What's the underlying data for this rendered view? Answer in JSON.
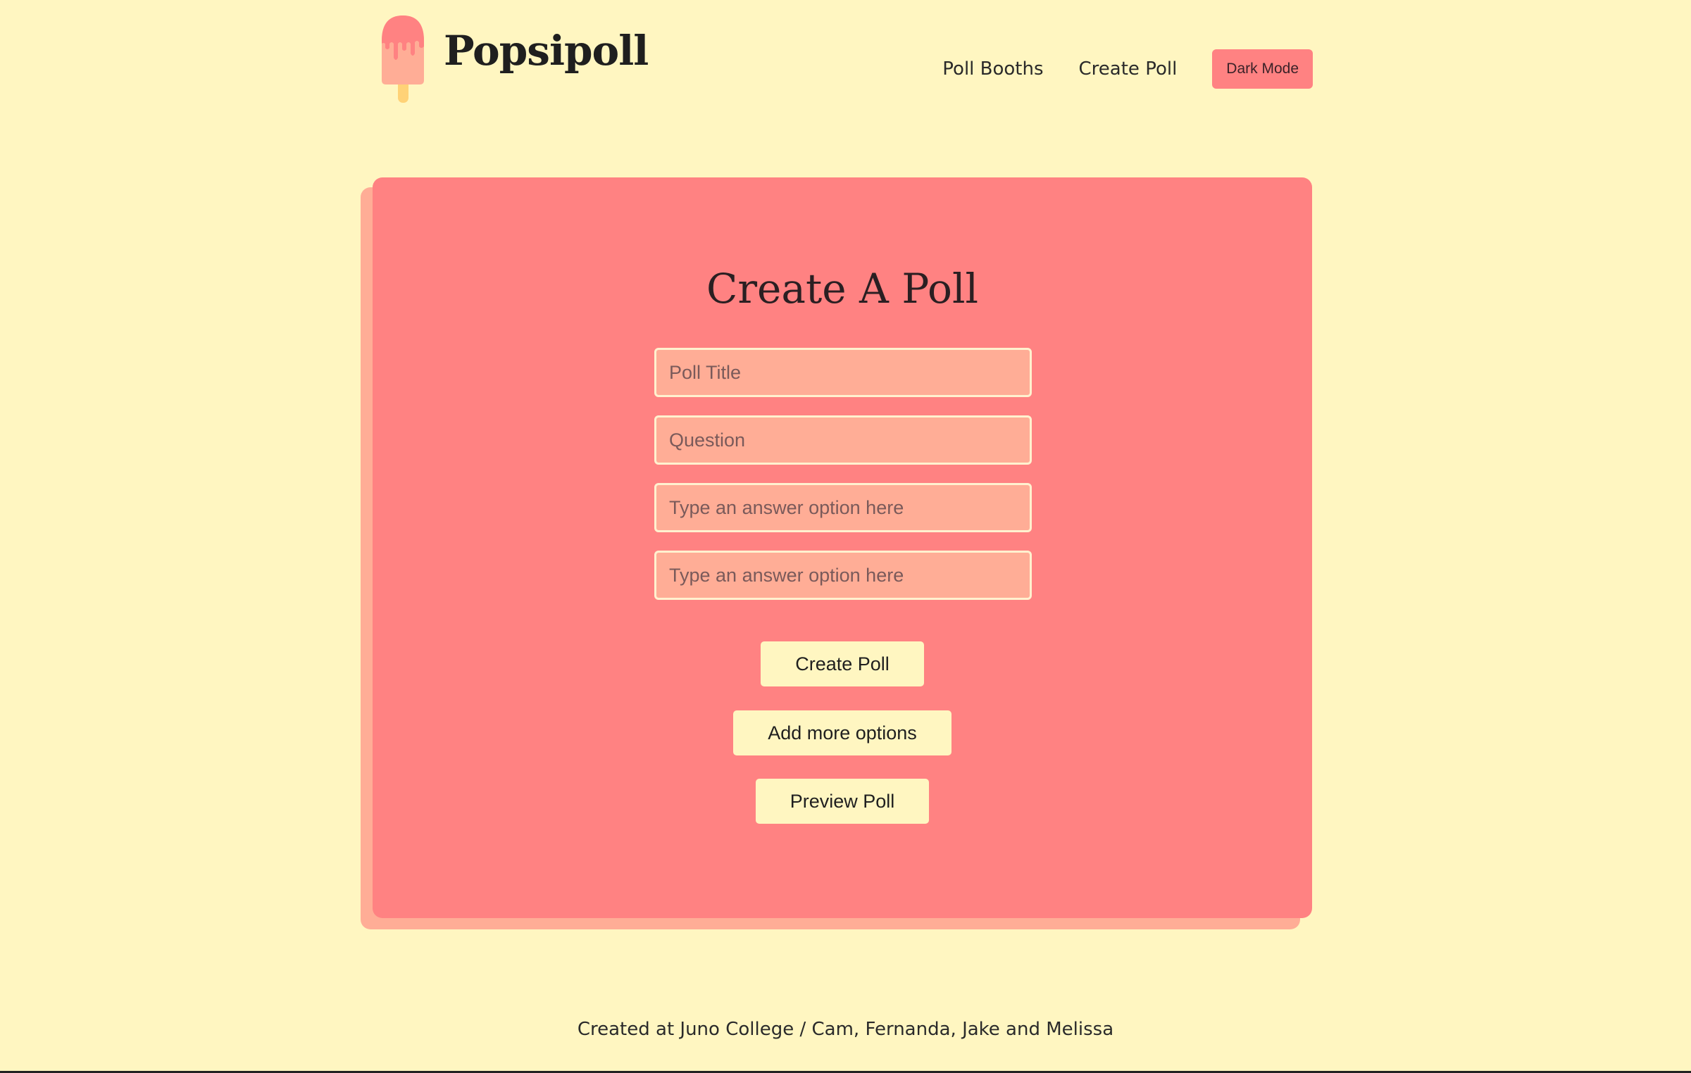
{
  "header": {
    "brand": "Popsipoll",
    "nav": {
      "poll_booths": "Poll Booths",
      "create_poll": "Create Poll",
      "dark_mode": "Dark Mode"
    }
  },
  "card": {
    "title": "Create A Poll",
    "fields": {
      "poll_title_placeholder": "Poll Title",
      "question_placeholder": "Question",
      "option1_placeholder": "Type an answer option here",
      "option2_placeholder": "Type an answer option here"
    },
    "buttons": {
      "create_poll": "Create Poll",
      "add_more_options": "Add more options",
      "preview_poll": "Preview Poll"
    }
  },
  "footer": {
    "text": "Created at Juno College / Cam, Fernanda, Jake and Melissa"
  },
  "colors": {
    "background": "#fff6c1",
    "card": "#ff8282",
    "card_shadow": "#ffad96",
    "field_bg": "#ffad96",
    "field_border": "#fff1cf",
    "button_bg": "#fff6c1"
  },
  "icons": {
    "logo": "popsicle-icon"
  }
}
